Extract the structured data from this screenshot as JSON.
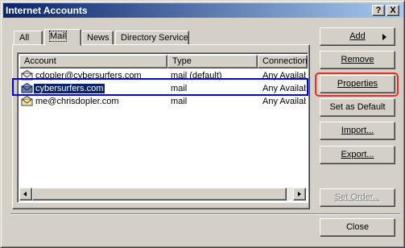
{
  "window": {
    "title": "Internet Accounts"
  },
  "titlebar_buttons": {
    "help": "?",
    "close": "X"
  },
  "tabs": [
    {
      "label": "All"
    },
    {
      "label": "Mail"
    },
    {
      "label": "News"
    },
    {
      "label": "Directory Service"
    }
  ],
  "columns": {
    "account": "Account",
    "type": "Type",
    "connection": "Connection"
  },
  "accounts": [
    {
      "account": "cdopler@cybersurfers.com",
      "type": "mail (default)",
      "connection": "Any Availab"
    },
    {
      "account": "cybersurfers.com",
      "type": "mail",
      "connection": "Any Availab"
    },
    {
      "account": "me@chrisdopler.com",
      "type": "mail",
      "connection": "Any Availab"
    }
  ],
  "buttons": {
    "add": "Add",
    "remove": "Remove",
    "properties": "Properties",
    "set_default": "Set as Default",
    "import": "Import...",
    "export": "Export...",
    "set_order": "Set Order...",
    "close": "Close"
  },
  "colors": {
    "annotation_blue": "#0000ff",
    "annotation_red": "#e0302a",
    "selection": "#0a246a"
  }
}
